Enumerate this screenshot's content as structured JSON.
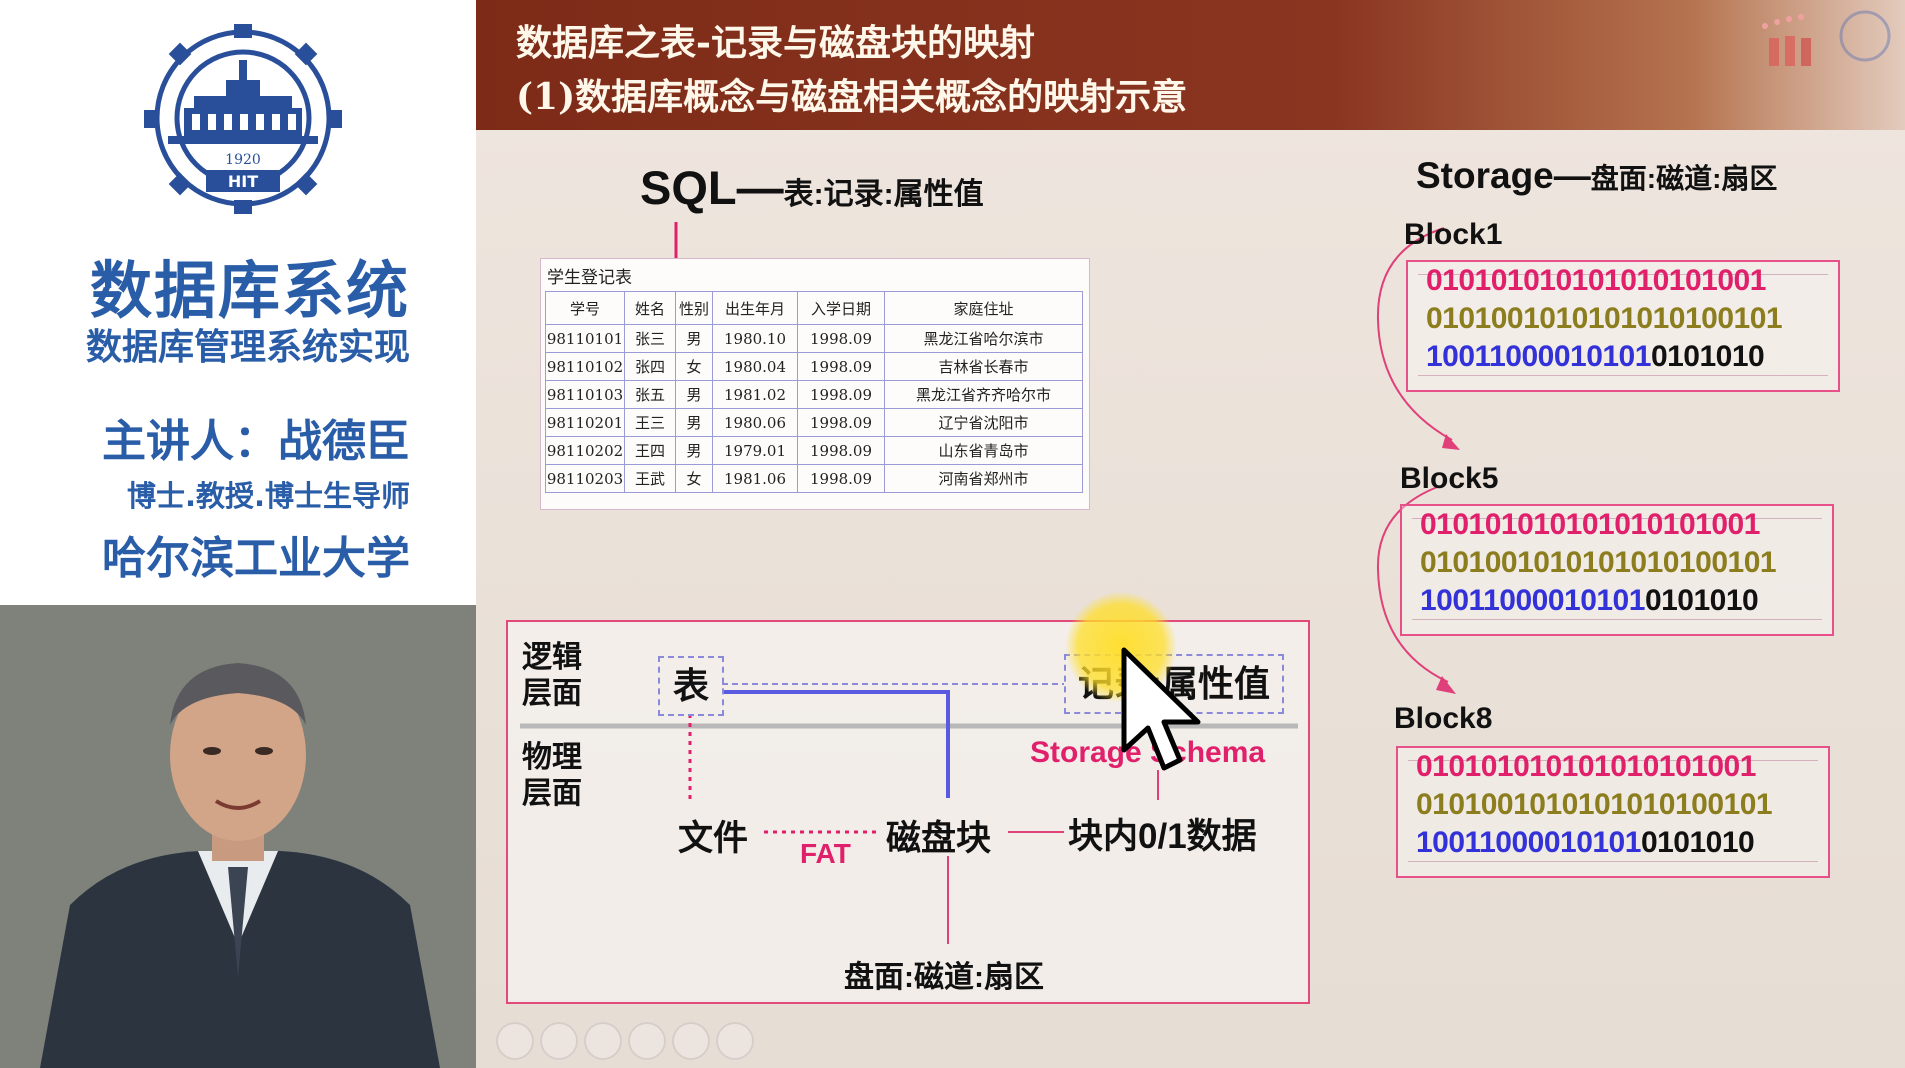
{
  "left_panel": {
    "logo": {
      "year": "1920",
      "abbr": "HIT"
    },
    "course_title": "数据库系统",
    "course_subtitle": "数据库管理系统实现",
    "lecturer": "主讲人：战德臣",
    "lecturer_title": "博士.教授.博士生导师",
    "university": "哈尔滨工业大学"
  },
  "slide": {
    "header": {
      "title_line1": "数据库之表-记录与磁盘块的映射",
      "title_line2": "(1)数据库概念与磁盘相关概念的映射示意"
    },
    "sql_heading": {
      "main": "SQL—",
      "rest": "表:记录:属性值"
    },
    "storage_heading": {
      "main": "Storage—",
      "rest": "盘面:磁道:扇区"
    },
    "table": {
      "caption": "学生登记表",
      "headers": [
        "学号",
        "姓名",
        "性别",
        "出生年月",
        "入学日期",
        "家庭住址"
      ],
      "rows": [
        [
          "98110101",
          "张三",
          "男",
          "1980.10",
          "1998.09",
          "黑龙江省哈尔滨市"
        ],
        [
          "98110102",
          "张四",
          "女",
          "1980.04",
          "1998.09",
          "吉林省长春市"
        ],
        [
          "98110103",
          "张五",
          "男",
          "1981.02",
          "1998.09",
          "黑龙江省齐齐哈尔市"
        ],
        [
          "98110201",
          "王三",
          "男",
          "1980.06",
          "1998.09",
          "辽宁省沈阳市"
        ],
        [
          "98110202",
          "王四",
          "男",
          "1979.01",
          "1998.09",
          "山东省青岛市"
        ],
        [
          "98110203",
          "王武",
          "女",
          "1981.06",
          "1998.09",
          "河南省郑州市"
        ]
      ]
    },
    "blocks": [
      {
        "label": "Block1",
        "row1": "010101010101010101001",
        "row2": "0101001010101010100101",
        "row3_a": "10011000010101",
        "row3_b": "0101010"
      },
      {
        "label": "Block5",
        "row1": "010101010101010101001",
        "row2": "0101001010101010100101",
        "row3_a": "10011000010101",
        "row3_b": "0101010"
      },
      {
        "label": "Block8",
        "row1": "010101010101010101001",
        "row2": "0101001010101010100101",
        "row3_a": "10011000010101",
        "row3_b": "0101010"
      }
    ],
    "diagram": {
      "logical_line1": "逻辑",
      "logical_line2": "层面",
      "physical_line1": "物理",
      "physical_line2": "层面",
      "table_node": "表",
      "record_node": "记录:属性值",
      "storage_schema": "Storage Schema",
      "file": "文件",
      "fat": "FAT",
      "disk_block": "磁盘块",
      "block_data": "块内0/1数据",
      "platter": "盘面:磁道:扇区"
    }
  },
  "colors": {
    "header_bg": "#7d2b18",
    "accent_pink": "#e0206a",
    "title_blue": "#2a5da8"
  }
}
